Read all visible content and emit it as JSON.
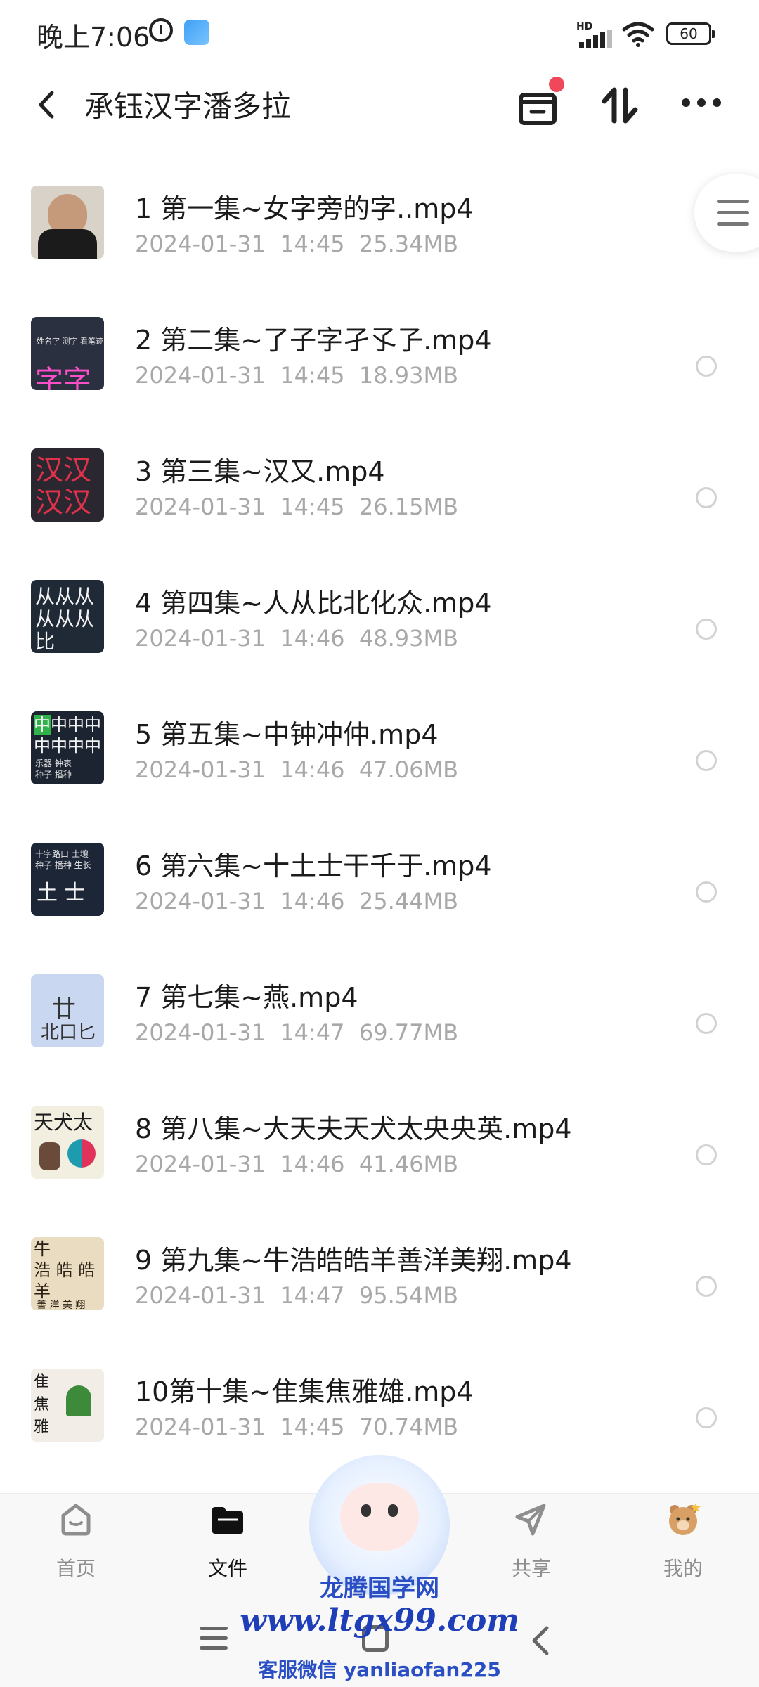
{
  "status": {
    "time": "晚上7:06",
    "network": "HD",
    "battery": "60"
  },
  "header": {
    "title": "承钰汉字潘多拉"
  },
  "files": [
    {
      "name": "1 第一集~女字旁的字..mp4",
      "date": "2024-01-31",
      "time": "14:45",
      "size": "25.34MB",
      "thumb_color": "#d9d2c8"
    },
    {
      "name": "2 第二集~了子字孑孓孒.mp4",
      "date": "2024-01-31",
      "time": "14:45",
      "size": "18.93MB",
      "thumb_color": "#2b3040"
    },
    {
      "name": "3 第三集~汉又.mp4",
      "date": "2024-01-31",
      "time": "14:45",
      "size": "26.15MB",
      "thumb_color": "#2a2730"
    },
    {
      "name": "4 第四集~人从比北化众.mp4",
      "date": "2024-01-31",
      "time": "14:46",
      "size": "48.93MB",
      "thumb_color": "#1f2a36"
    },
    {
      "name": "5 第五集~中钟冲仲.mp4",
      "date": "2024-01-31",
      "time": "14:46",
      "size": "47.06MB",
      "thumb_color": "#1d2431"
    },
    {
      "name": "6 第六集~十土士干千于.mp4",
      "date": "2024-01-31",
      "time": "14:46",
      "size": "25.44MB",
      "thumb_color": "#1d2636"
    },
    {
      "name": "7 第七集~燕.mp4",
      "date": "2024-01-31",
      "time": "14:47",
      "size": "69.77MB",
      "thumb_color": "#c9d8f0"
    },
    {
      "name": "8 第八集~大天夫天犬太央央英.mp4",
      "date": "2024-01-31",
      "time": "14:46",
      "size": "41.46MB",
      "thumb_color": "#f3efe0"
    },
    {
      "name": "9 第九集~牛浩皓皓羊善洋美翔.mp4",
      "date": "2024-01-31",
      "time": "14:47",
      "size": "95.54MB",
      "thumb_color": "#e9dcc0"
    },
    {
      "name": "10第十集~隹集焦雅雄.mp4",
      "date": "2024-01-31",
      "time": "14:45",
      "size": "70.74MB",
      "thumb_color": "#f2ede6"
    }
  ],
  "tabs": [
    {
      "label": "首页",
      "icon": "home-icon"
    },
    {
      "label": "文件",
      "icon": "folder-icon",
      "active": true
    },
    {
      "label": "共享",
      "icon": "share-icon"
    },
    {
      "label": "我的",
      "icon": "profile-icon"
    }
  ],
  "watermark": {
    "title": "龙腾国学网",
    "url": "www.ltgx99.com",
    "wechat": "客服微信 yanliaofan225"
  },
  "colors": {
    "accent": "#111111",
    "badge": "#f0485a",
    "meta": "#a8a8a8"
  }
}
